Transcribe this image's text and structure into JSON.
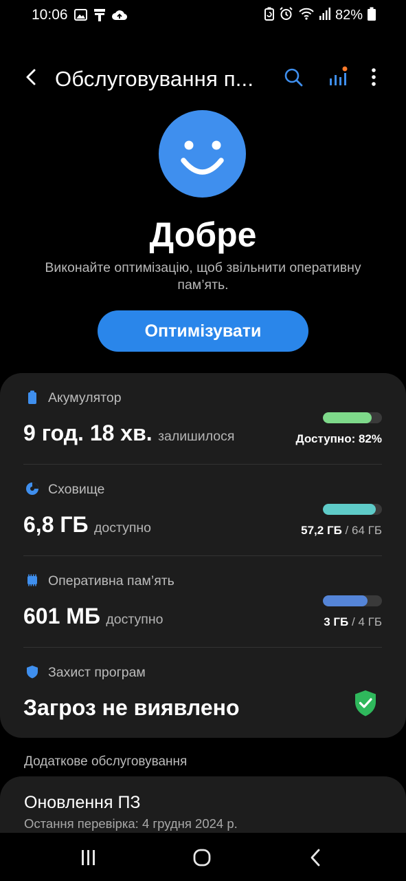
{
  "status_bar": {
    "time": "10:06",
    "battery_percent": "82%",
    "left_icons": [
      "image-icon",
      "usb-icon",
      "cloud-sync-icon"
    ],
    "right_icons": [
      "battery-saver-icon",
      "alarm-icon",
      "wifi-icon",
      "signal-icon",
      "battery-icon"
    ]
  },
  "app_bar": {
    "title": "Обслуговування п...",
    "icons": [
      "back-arrow-icon",
      "search-icon",
      "stats-icon",
      "more-vert-icon"
    ],
    "accent": "#3f8fee",
    "notify_dot": "#ff7a2a"
  },
  "hero": {
    "icon": "smiley-face-icon",
    "status": "Добре",
    "hint": "Виконайте оптимізацію, щоб звільнити оперативну пам’ять.",
    "button": "Оптимізувати"
  },
  "items": {
    "battery": {
      "icon": "battery-icon",
      "label": "Акумулятор",
      "value": "9 год. 18 хв.",
      "value_suffix": "залишилося",
      "bar_fraction": 0.82,
      "bar_color": "#7ed98a",
      "right": "Доступно: 82%"
    },
    "storage": {
      "icon": "pie-chart-icon",
      "label": "Сховище",
      "value": "6,8 ГБ",
      "value_suffix": "доступно",
      "bar_fraction": 0.894,
      "bar_color": "#5ecbc8",
      "right_used": "57,2 ГБ",
      "right_total": "/ 64 ГБ"
    },
    "memory": {
      "icon": "memory-chip-icon",
      "label": "Оперативна пам’ять",
      "value": "601 МБ",
      "value_suffix": "доступно",
      "bar_fraction": 0.75,
      "bar_color": "#5585d8",
      "right_used": "3 ГБ",
      "right_total": "/ 4 ГБ"
    },
    "protection": {
      "icon": "shield-icon",
      "label": "Захист програм",
      "value": "Загроз не виявлено",
      "badge_icon": "shield-check-icon",
      "badge_color": "#2fb85c"
    }
  },
  "additional": {
    "header": "Додаткове обслуговування",
    "update": {
      "title": "Оновлення ПЗ",
      "subtitle": "Остання перевірка: 4 грудня 2024 р."
    }
  },
  "nav_bar": {
    "icons": [
      "recents-icon",
      "home-icon",
      "back-icon"
    ]
  }
}
